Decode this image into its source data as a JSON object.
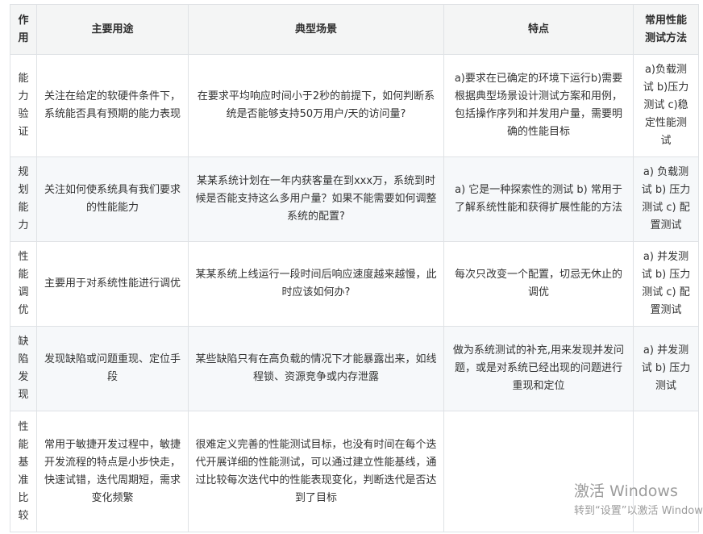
{
  "table": {
    "headers": [
      "作用",
      "主要用途",
      "典型场景",
      "特点",
      "常用性能测试方法"
    ],
    "rows": [
      {
        "type": "能力验证",
        "purpose": "关注在给定的软硬件条件下，系统能否具有预期的能力表现",
        "scenario": "在要求平均响应时间小于2秒的前提下，如何判断系统是否能够支持50万用户/天的访问量?",
        "features": "a)要求在已确定的环境下运行b)需要根据典型场景设计测试方案和用例，包括操作序列和并发用户量，需要明确的性能目标",
        "methods": "a)负载测试 b)压力测试 c)稳定性能测试"
      },
      {
        "type": "规划能力",
        "purpose": "关注如何使系统具有我们要求的性能能力",
        "scenario": "某某系统计划在一年内获客量在到xxx万，系统到时候是否能支持这么多用户量？如果不能需要如何调整系统的配置?",
        "features": "a) 它是一种探索性的测试 b) 常用于了解系统性能和获得扩展性能的方法",
        "methods": "a) 负载测试 b) 压力测试 c) 配置测试"
      },
      {
        "type": "性能调优",
        "purpose": "主要用于对系统性能进行调优",
        "scenario": "某某系统上线运行一段时间后响应速度越来越慢，此时应该如何办?",
        "features": "每次只改变一个配置，切忌无休止的调优",
        "methods": "a) 并发测试 b) 压力测试 c) 配置测试"
      },
      {
        "type": "缺陷发现",
        "purpose": "发现缺陷或问题重现、定位手段",
        "scenario": "某些缺陷只有在高负载的情况下才能暴露出来，如线程锁、资源竞争或内存泄露",
        "features": "做为系统测试的补充,用来发现并发问题，或是对系统已经出现的问题进行重现和定位",
        "methods": "a) 并发测试 b) 压力测试"
      },
      {
        "type": "性能基准比较",
        "purpose": "常用于敏捷开发过程中，敏捷开发流程的特点是小步快走，快速试错，迭代周期短，需求变化频繁",
        "scenario": "很难定义完善的性能测试目标，也没有时间在每个迭代开展详细的性能测试，可以通过建立性能基线，通过比较每次迭代中的性能表现变化，判断迭代是否达到了目标",
        "features": "",
        "methods": ""
      }
    ]
  },
  "watermark": {
    "title": "激活 Windows",
    "subtitle": "转到“设置”以激活 Windows。"
  }
}
